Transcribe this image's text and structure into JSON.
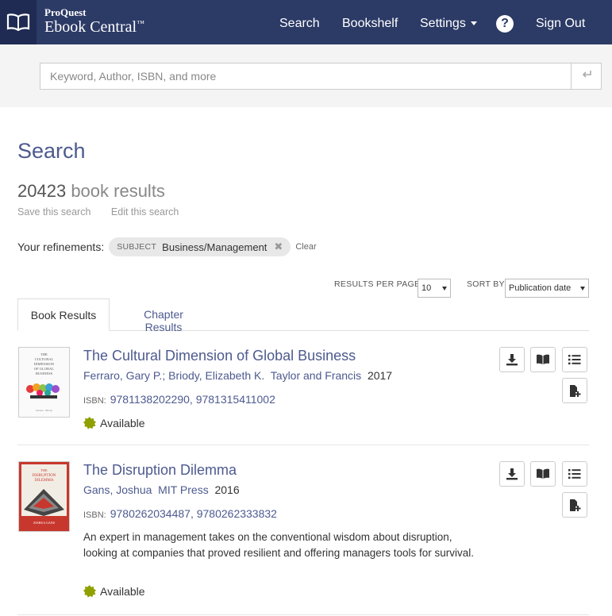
{
  "header": {
    "brand_top": "ProQuest",
    "brand_main": "Ebook Central",
    "brand_tm": "™",
    "nav": {
      "search": "Search",
      "bookshelf": "Bookshelf",
      "settings": "Settings",
      "help": "?",
      "signout": "Sign Out"
    }
  },
  "search": {
    "placeholder": "Keyword, Author, ISBN, and more",
    "value": ""
  },
  "page": {
    "title": "Search",
    "count": "20423",
    "count_label": "book results",
    "save_search": "Save this search",
    "edit_search": "Edit this search"
  },
  "refinements": {
    "label": "Your refinements:",
    "chip_key": "SUBJECT",
    "chip_value": "Business/Management",
    "clear": "Clear"
  },
  "controls": {
    "rpp_label": "RESULTS PER PAGE",
    "rpp_value": "10",
    "sort_label": "SORT BY",
    "sort_value": "Publication date"
  },
  "tabs": {
    "book": "Book Results",
    "chapter": "Chapter Results"
  },
  "results": [
    {
      "title": "The Cultural Dimension of Global Business",
      "authors": "Ferraro, Gary P.; Briody, Elizabeth K.",
      "publisher": "Taylor and Francis",
      "year": "2017",
      "isbn_label": "ISBN:",
      "isbns": "9781138202290, 9781315411002",
      "description": "",
      "availability": "Available",
      "cover_text": "THE CULTURAL DIMENSION OF GLOBAL BUSINESS"
    },
    {
      "title": "The Disruption Dilemma",
      "authors": "Gans, Joshua",
      "publisher": "MIT Press",
      "year": "2016",
      "isbn_label": "ISBN:",
      "isbns": "9780262034487, 9780262333832",
      "description": "An expert in management takes on the conventional wisdom about disruption, looking at companies that proved resilient and offering managers tools for survival.",
      "availability": "Available",
      "cover_text": "THE DISRUPTION DILEMMA",
      "cover_author": "JOSHUA GANS"
    }
  ],
  "colors": {
    "header_bg": "#2c3a66",
    "link": "#4d5a8f",
    "available_seal": "#8fa000",
    "cover_red": "#c8372d"
  }
}
